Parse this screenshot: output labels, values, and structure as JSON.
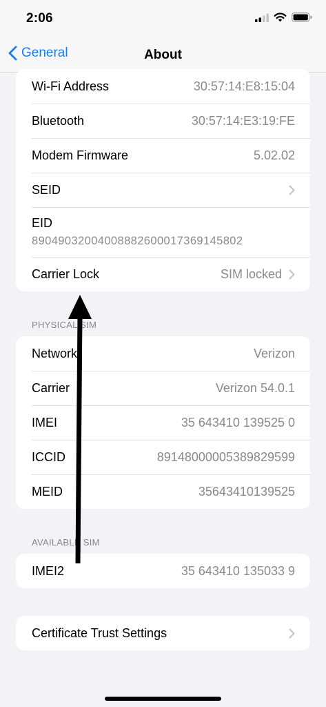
{
  "status_bar": {
    "time": "2:06"
  },
  "nav": {
    "back_label": "General",
    "title": "About"
  },
  "group1": [
    {
      "label": "Wi-Fi Address",
      "value": "30:57:14:E8:15:04"
    },
    {
      "label": "Bluetooth",
      "value": "30:57:14:E3:19:FE"
    },
    {
      "label": "Modem Firmware",
      "value": "5.02.02"
    },
    {
      "label": "SEID",
      "value": ""
    },
    {
      "label": "EID",
      "value": "89049032004008882600017369145802"
    },
    {
      "label": "Carrier Lock",
      "value": "SIM locked"
    }
  ],
  "physical_sim": {
    "header": "PHYSICAL SIM",
    "rows": [
      {
        "label": "Network",
        "value": "Verizon"
      },
      {
        "label": "Carrier",
        "value": "Verizon 54.0.1"
      },
      {
        "label": "IMEI",
        "value": "35 643410 139525 0"
      },
      {
        "label": "ICCID",
        "value": "89148000005389829599"
      },
      {
        "label": "MEID",
        "value": "35643410139525"
      }
    ]
  },
  "available_sim": {
    "header": "AVAILABLE SIM",
    "rows": [
      {
        "label": "IMEI2",
        "value": "35 643410 135033 9"
      }
    ]
  },
  "certificate": {
    "label": "Certificate Trust Settings"
  },
  "colors": {
    "accent": "#1a7cf5",
    "background": "#f2f2f7",
    "secondary_text": "#8a8a8e"
  },
  "icons": [
    "cellular-signal-icon",
    "wifi-icon",
    "battery-icon",
    "chevron-left-icon",
    "chevron-right-icon",
    "annotation-arrow"
  ]
}
